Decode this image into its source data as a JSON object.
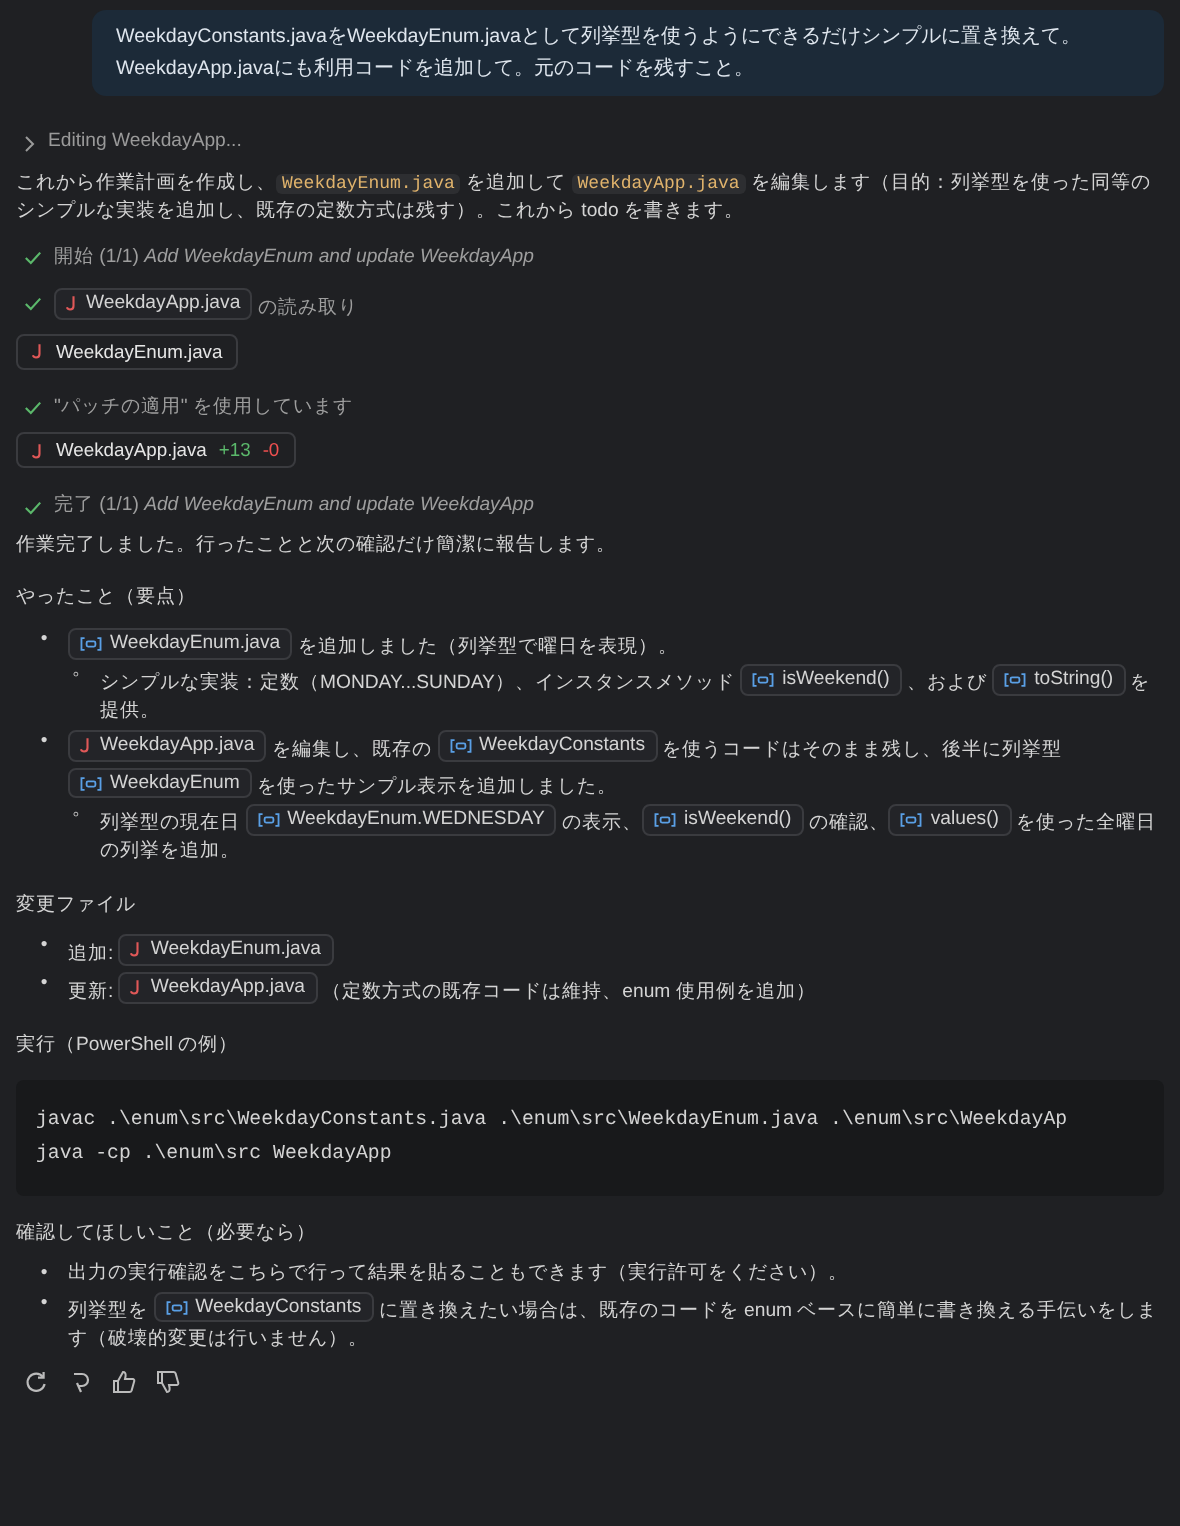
{
  "user_message": {
    "lines": [
      "WeekdayConstants.javaをWeekdayEnum.javaとして列挙型を使うようにできるだけシンプルに置き換えて。",
      "WeekdayApp.javaにも利用コードを追加して。元のコードを残すこと。"
    ]
  },
  "progress": {
    "label": "Editing WeekdayApp...",
    "expanded": false
  },
  "blocks": [
    {
      "kind": "paragraph",
      "segments": [
        {
          "kind": "text",
          "text": "これから作業計画を作成し、"
        },
        {
          "kind": "code",
          "text": "WeekdayEnum.java"
        },
        {
          "kind": "text",
          "text": " を追加して "
        },
        {
          "kind": "code",
          "text": "WeekdayApp.java"
        },
        {
          "kind": "text",
          "text": " を編集します（目的：列挙型を使った同等のシンプルな実装を追加し、既存の定数方式は残す）。これから todo を書きます。"
        }
      ]
    },
    {
      "kind": "step",
      "done": true,
      "segments": [
        {
          "kind": "text",
          "text": "開始 (1/1) "
        },
        {
          "kind": "em",
          "text": "Add WeekdayEnum and update WeekdayApp"
        }
      ]
    },
    {
      "kind": "step",
      "done": true,
      "segments": [
        {
          "kind": "file",
          "text": "WeekdayApp.java"
        },
        {
          "kind": "text",
          "text": " の読み取り"
        }
      ]
    },
    {
      "kind": "file_card",
      "name": "WeekdayEnum.java"
    },
    {
      "kind": "step",
      "done": true,
      "segments": [
        {
          "kind": "text",
          "text": "\"パッチの適用\" を使用しています"
        }
      ]
    },
    {
      "kind": "diff_card",
      "name": "WeekdayApp.java",
      "added": "+13",
      "removed": "-0"
    },
    {
      "kind": "step",
      "done": true,
      "segments": [
        {
          "kind": "text",
          "text": "完了 (1/1) "
        },
        {
          "kind": "em",
          "text": "Add WeekdayEnum and update WeekdayApp"
        }
      ]
    },
    {
      "kind": "paragraph",
      "segments": [
        {
          "kind": "text",
          "text": "作業完了しました。行ったことと次の確認だけ簡潔に報告します。"
        }
      ]
    },
    {
      "kind": "heading",
      "text": "やったこと（要点）"
    },
    {
      "kind": "bullets",
      "items": [
        {
          "marker": "•",
          "segments": [
            {
              "kind": "symbol",
              "text": "WeekdayEnum.java"
            },
            {
              "kind": "text",
              "text": " を追加しました（列挙型で曜日を表現）。"
            }
          ],
          "children": [
            {
              "marker": "◦",
              "segments": [
                {
                  "kind": "text",
                  "text": "シンプルな実装：定数（MONDAY...SUNDAY）、インスタンスメソッド "
                },
                {
                  "kind": "symbol",
                  "text": "isWeekend()"
                },
                {
                  "kind": "text",
                  "text": " 、および "
                },
                {
                  "kind": "symbol",
                  "text": "toString()"
                },
                {
                  "kind": "text",
                  "text": " を提供。"
                }
              ]
            }
          ]
        },
        {
          "marker": "•",
          "segments": [
            {
              "kind": "file",
              "text": "WeekdayApp.java"
            },
            {
              "kind": "text",
              "text": " を編集し、既存の "
            },
            {
              "kind": "symbol",
              "text": "WeekdayConstants"
            },
            {
              "kind": "text",
              "text": " を使うコードはそのまま残し、後半に列挙型 "
            },
            {
              "kind": "symbol",
              "text": "WeekdayEnum"
            },
            {
              "kind": "text",
              "text": " を使ったサンプル表示を追加しました。"
            }
          ],
          "children": [
            {
              "marker": "◦",
              "segments": [
                {
                  "kind": "text",
                  "text": "列挙型の現在日 "
                },
                {
                  "kind": "symbol",
                  "text": "WeekdayEnum.WEDNESDAY"
                },
                {
                  "kind": "text",
                  "text": " の表示、"
                },
                {
                  "kind": "symbol",
                  "text": "isWeekend()"
                },
                {
                  "kind": "text",
                  "text": " の確認、"
                },
                {
                  "kind": "symbol",
                  "text": "values()"
                },
                {
                  "kind": "text",
                  "text": " を使った全曜日の列挙を追加。"
                }
              ]
            }
          ]
        }
      ]
    },
    {
      "kind": "heading",
      "text": "変更ファイル"
    },
    {
      "kind": "bullets",
      "items": [
        {
          "marker": "•",
          "segments": [
            {
              "kind": "text",
              "text": "追加: "
            },
            {
              "kind": "file",
              "text": "WeekdayEnum.java"
            }
          ]
        },
        {
          "marker": "•",
          "segments": [
            {
              "kind": "text",
              "text": "更新: "
            },
            {
              "kind": "file",
              "text": "WeekdayApp.java"
            },
            {
              "kind": "text",
              "text": " （定数方式の既存コードは維持、enum 使用例を追加）"
            }
          ]
        }
      ]
    },
    {
      "kind": "heading",
      "text": "実行（PowerShell の例）"
    },
    {
      "kind": "code_block",
      "lines": [
        "javac .\\enum\\src\\WeekdayConstants.java .\\enum\\src\\WeekdayEnum.java .\\enum\\src\\WeekdayAp",
        "java -cp .\\enum\\src WeekdayApp"
      ]
    },
    {
      "kind": "heading",
      "text": "確認してほしいこと（必要なら）"
    },
    {
      "kind": "bullets",
      "items": [
        {
          "marker": "•",
          "segments": [
            {
              "kind": "text",
              "text": "出力の実行確認をこちらで行って結果を貼ることもできます（実行許可をください）。"
            }
          ]
        },
        {
          "marker": "•",
          "segments": [
            {
              "kind": "text",
              "text": "列挙型を "
            },
            {
              "kind": "symbol",
              "text": "WeekdayConstants"
            },
            {
              "kind": "text",
              "text": " に置き換えたい場合は、既存のコードを enum ベースに簡単に書き換える手伝いをします（破壊的変更は行いません）。"
            }
          ]
        }
      ]
    }
  ]
}
